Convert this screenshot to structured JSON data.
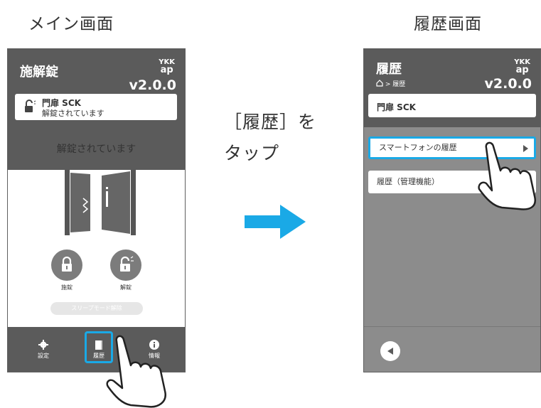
{
  "captions": {
    "left": "メイン画面",
    "right": "履歴画面",
    "instruction_line1": "［履歴］を",
    "instruction_line2": "タップ"
  },
  "logo": {
    "top": "YKK",
    "bottom": "ap"
  },
  "main_screen": {
    "title": "施解錠",
    "version": "v2.0.0",
    "door_name": "門扉 SCK",
    "door_status": "解錠されています",
    "status_heading": "解錠されています",
    "lock_label": "施錠",
    "unlock_label": "解錠",
    "sleep_label": "スリープモード解除",
    "footer": {
      "settings": "設定",
      "history": "履歴",
      "info": "情報"
    }
  },
  "history_screen": {
    "title": "履歴",
    "breadcrumb": "> 履歴",
    "version": "v2.0.0",
    "door_name": "門扉 SCK",
    "items": [
      {
        "label": "スマートフォンの履歴"
      },
      {
        "label": "履歴（管理機能）"
      }
    ]
  },
  "colors": {
    "highlight": "#1aa9e6",
    "header": "#5b5b5b",
    "arrow": "#1aa9e6"
  }
}
